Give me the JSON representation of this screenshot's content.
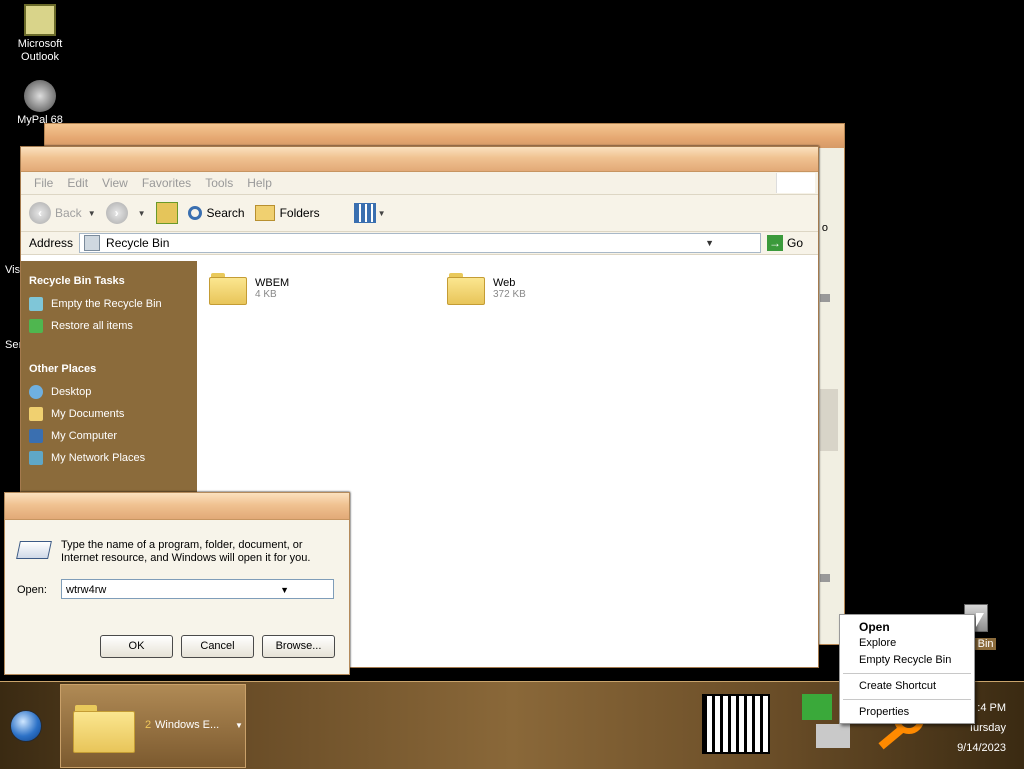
{
  "desktop": {
    "icons": [
      {
        "label": "Microsoft Outlook",
        "icon": "outlook-icon"
      },
      {
        "label": "MyPal 68",
        "icon": "raccoon-icon"
      }
    ],
    "partial_labels": [
      "Vis",
      "Ser"
    ],
    "recycle_bin_label": "le Bin"
  },
  "explorer": {
    "menu": [
      "File",
      "Edit",
      "View",
      "Favorites",
      "Tools",
      "Help"
    ],
    "toolbar": {
      "back": "Back",
      "search": "Search",
      "folders": "Folders"
    },
    "address_label": "Address",
    "address_value": "Recycle Bin",
    "go_label": "Go",
    "sidebar": {
      "tasks_heading": "Recycle Bin Tasks",
      "tasks": [
        "Empty the Recycle Bin",
        "Restore all items"
      ],
      "places_heading": "Other Places",
      "places": [
        "Desktop",
        "My Documents",
        "My Computer",
        "My Network Places"
      ]
    },
    "files": [
      {
        "name": "WBEM",
        "size": "4 KB"
      },
      {
        "name": "Web",
        "size": "372 KB"
      }
    ]
  },
  "back_window": {
    "partial_text": "o"
  },
  "run_dialog": {
    "description": "Type the name of a program, folder, document, or Internet resource, and Windows will open it for you.",
    "open_label": "Open:",
    "open_value": "wtrw4rw",
    "ok_label": "OK",
    "cancel_label": "Cancel",
    "browse_label": "Browse..."
  },
  "taskbar": {
    "task_count": "2",
    "task_label": "Windows E...",
    "clock_time": ":4 PM",
    "clock_day": "ıursday",
    "clock_date": "9/14/2023"
  },
  "context_menu": {
    "items": [
      "Open",
      "Explore",
      "Empty Recycle Bin",
      "Create Shortcut",
      "Properties"
    ]
  }
}
